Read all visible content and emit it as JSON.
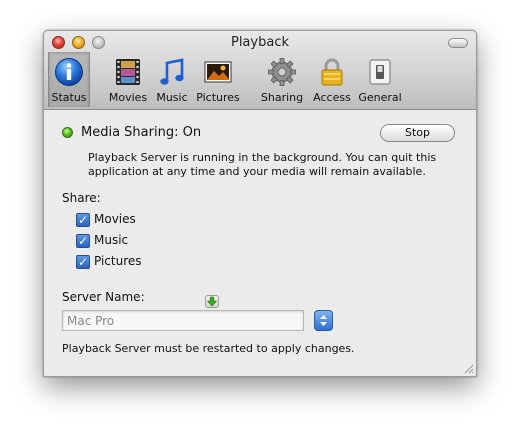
{
  "window": {
    "title": "Playback"
  },
  "toolbar": {
    "tabs": [
      {
        "id": "status",
        "label": "Status",
        "icon": "info-icon",
        "selected": true
      },
      {
        "id": "movies",
        "label": "Movies",
        "icon": "film-icon",
        "selected": false
      },
      {
        "id": "music",
        "label": "Music",
        "icon": "music-note-icon",
        "selected": false
      },
      {
        "id": "pictures",
        "label": "Pictures",
        "icon": "photo-icon",
        "selected": false
      },
      {
        "id": "sharing",
        "label": "Sharing",
        "icon": "gear-icon",
        "selected": false
      },
      {
        "id": "access",
        "label": "Access",
        "icon": "lock-icon",
        "selected": false
      },
      {
        "id": "general",
        "label": "General",
        "icon": "switch-icon",
        "selected": false
      }
    ]
  },
  "status": {
    "title": "Media Sharing: On",
    "indicator_color": "#54c21d",
    "stop_label": "Stop",
    "description": "Playback Server is running in the background. You can quit this application at any time and your media will remain available."
  },
  "share": {
    "label": "Share:",
    "items": [
      {
        "label": "Movies",
        "checked": true
      },
      {
        "label": "Music",
        "checked": true
      },
      {
        "label": "Pictures",
        "checked": true
      }
    ]
  },
  "server": {
    "label": "Server Name:",
    "value": "Mac Pro",
    "restart_note": "Playback Server must be restarted to apply changes."
  },
  "colors": {
    "accent": "#2a62c0",
    "window_bg": "#ebebeb"
  }
}
